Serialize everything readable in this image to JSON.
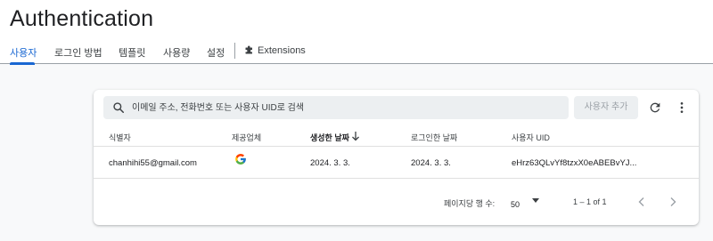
{
  "header": {
    "title": "Authentication"
  },
  "tabs": [
    {
      "label": "사용자",
      "active": true
    },
    {
      "label": "로그인 방법"
    },
    {
      "label": "템플릿"
    },
    {
      "label": "사용량"
    },
    {
      "label": "설정"
    },
    {
      "label": "Extensions",
      "icon": "extensions-icon"
    }
  ],
  "toolbar": {
    "search_placeholder": "이메일 주소, 전화번호 또는 사용자 UID로 검색",
    "add_user_label": "사용자 추가",
    "refresh_icon": "refresh-icon",
    "more_icon": "more-vert-icon"
  },
  "table": {
    "columns": [
      "식별자",
      "제공업체",
      "생성한 날짜",
      "로그인한 날짜",
      "사용자 UID"
    ],
    "sorted_column": "생성한 날짜",
    "sort_direction": "descending",
    "rows": [
      {
        "identifier": "chanhihi55@gmail.com",
        "provider_icon": "google-icon",
        "created": "2024. 3. 3.",
        "signed_in": "2024. 3. 3.",
        "uid": "eHrz63QLvYf8tzxX0eABEBvYJ..."
      }
    ]
  },
  "pagination": {
    "rows_per_page_label": "페이지당 행 수:",
    "rows_per_page_value": "50",
    "range": "1 – 1 of 1"
  },
  "colors": {
    "accent": "#1967d2",
    "background": "#f8f9fa",
    "card": "#ffffff",
    "search_bg": "#eceff1"
  }
}
